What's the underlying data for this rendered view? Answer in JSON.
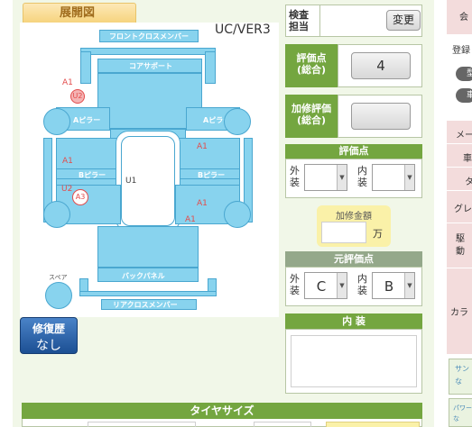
{
  "diagram": {
    "tab_title": "展開図",
    "model_code": "UC/VER3",
    "parts": {
      "front_cross_member": "フロントクロスメンバー",
      "core_support": "コアサポート",
      "a_pillar_left": "Aピラー",
      "a_pillar_right": "Aピラー",
      "b_pillar_left": "Bピラー",
      "b_pillar_right": "Bピラー",
      "back_panel": "バックパネル",
      "rear_cross_member": "リアクロスメンバー",
      "spare_label": "スペア"
    },
    "marks": {
      "a1_front_left": "A1",
      "u2_front_left": "U2",
      "a1_mid_right": "A1",
      "a1_left_side": "A1",
      "u1_roof": "U1",
      "u2_left_rear": "U2",
      "a3_left_rear": "A3",
      "a1_right_side": "A1",
      "a1_right_lower": "A1"
    }
  },
  "repair_history": {
    "label": "修復歴",
    "value": "なし"
  },
  "inspector": {
    "label": "検査\n担当",
    "change_button": "変更"
  },
  "evaluation": {
    "label": "評価点\n(総合)",
    "value": "4"
  },
  "repair_evaluation": {
    "label": "加修評価\n(総合)",
    "value": ""
  },
  "grade": {
    "header": "評価点",
    "exterior_label": "外\n装",
    "exterior_value": "",
    "interior_label": "内\n装",
    "interior_value": ""
  },
  "repair_cost": {
    "label": "加修金額",
    "value": "",
    "unit": "万"
  },
  "original_grade": {
    "header": "元評価点",
    "exterior_label": "外\n装",
    "exterior_value": "C",
    "interior_label": "内\n装",
    "interior_value": "B"
  },
  "interior": {
    "header": "内 装",
    "text": ""
  },
  "tire": {
    "header": "タイヤサイズ"
  },
  "right_strip": {
    "item1": "会",
    "item2": "登録",
    "item3": "型",
    "item4": "車",
    "item5": "メー",
    "item6": "車",
    "item7": "タ",
    "item8": "グレ",
    "item9": "駆\n動",
    "item10": "カラ",
    "item11": "サン\nな",
    "item12": "パワー\nな"
  },
  "colors": {
    "accent_green": "#74a640",
    "car_blue": "#88d3ee",
    "damage_red": "#e34c4c",
    "repair_blue": "#1c4f93"
  }
}
